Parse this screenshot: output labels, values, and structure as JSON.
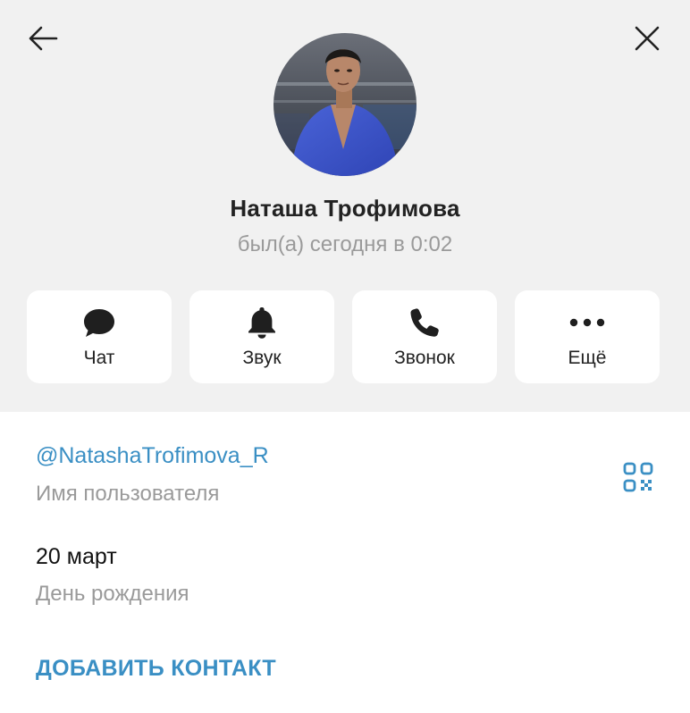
{
  "header": {
    "back_icon": "arrow-left-icon",
    "close_icon": "close-icon",
    "avatar": "profile-photo"
  },
  "profile": {
    "name": "Наташа Трофимова",
    "status": "был(а) сегодня в 0:02"
  },
  "actions": [
    {
      "label": "Чат",
      "icon": "chat-bubble-icon"
    },
    {
      "label": "Звук",
      "icon": "bell-icon"
    },
    {
      "label": "Звонок",
      "icon": "phone-icon"
    },
    {
      "label": "Ещё",
      "icon": "more-dots-icon"
    }
  ],
  "info": {
    "username": "@NatashaTrofimova_R",
    "username_caption": "Имя пользователя",
    "qr_icon": "qr-code-icon",
    "birthday": "20 март",
    "birthday_caption": "День рождения"
  },
  "footer": {
    "add_contact": "ДОБАВИТЬ КОНТАКТ"
  },
  "colors": {
    "header_bg": "#f1f1f1",
    "accent": "#3a8fc4",
    "text": "#222222",
    "muted": "#9a9a9a"
  }
}
